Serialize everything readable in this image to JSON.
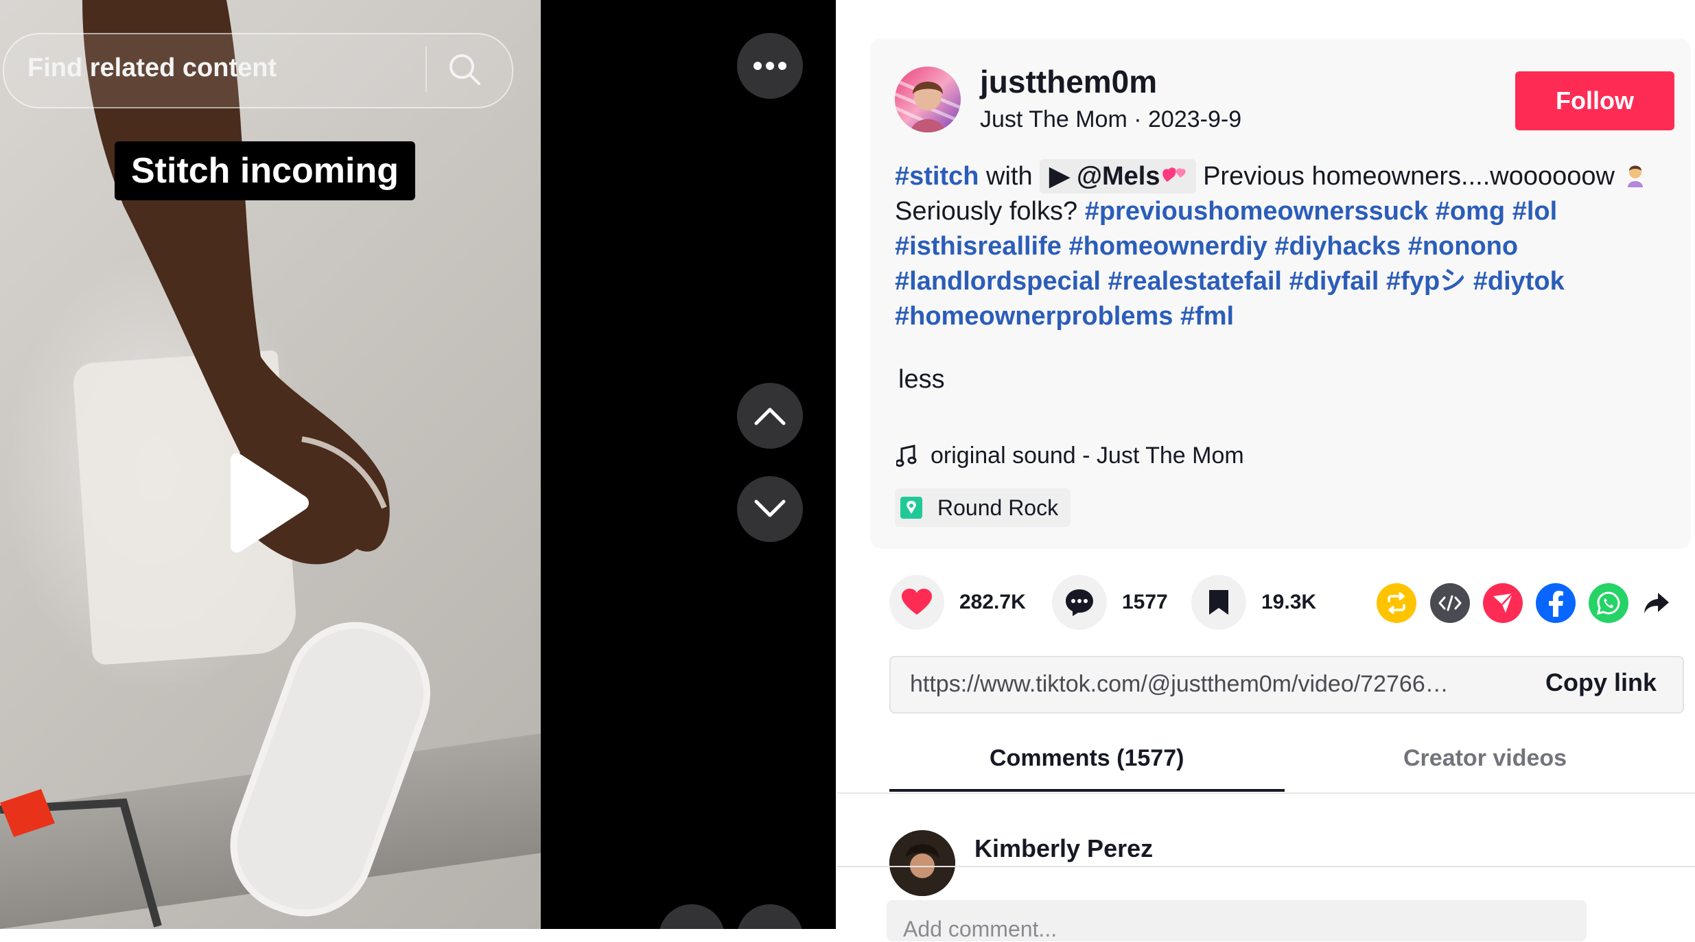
{
  "search": {
    "placeholder": "Find related content"
  },
  "video": {
    "caption": "Stitch incoming"
  },
  "author": {
    "username": "justthem0m",
    "nickname": "Just The Mom",
    "date": "2023-9-9",
    "follow_label": "Follow"
  },
  "description": {
    "stitch_tag": "#stitch",
    "with_text": "with",
    "stitch_mention": "@Mels",
    "text_1": "Previous homeowners....woooooow",
    "text_2": "Seriously folks?",
    "hashtags": [
      "#previoushomeownerssuck",
      "#omg",
      "#lol",
      "#isthisreallife",
      "#homeownerdiy",
      "#diyhacks",
      "#nonono",
      "#landlordspecial",
      "#realestatefail",
      "#diyfail",
      "#fypシ",
      "#diytok",
      "#homeownerproblems",
      "#fml"
    ],
    "less_label": "less"
  },
  "sound": {
    "label": "original sound - Just The Mom"
  },
  "location": {
    "label": "Round Rock"
  },
  "stats": {
    "likes": "282.7K",
    "comments": "1577",
    "saves": "19.3K"
  },
  "share": {
    "icons": [
      "repost-icon",
      "embed-icon",
      "send-icon",
      "facebook-icon",
      "whatsapp-icon",
      "share-arrow-icon"
    ],
    "colors": {
      "repost": "#ffc300",
      "embed": "#4a4a52",
      "send": "#fe2c55",
      "facebook": "#0866ff",
      "whatsapp": "#25d366"
    }
  },
  "link": {
    "url": "https://www.tiktok.com/@justthem0m/video/72766370...",
    "copy_label": "Copy link"
  },
  "tabs": {
    "comments": "Comments (1577)",
    "creator_videos": "Creator videos"
  },
  "comments": [
    {
      "name": "Kimberly Perez"
    }
  ],
  "comment_input": {
    "placeholder": "Add comment..."
  },
  "colors": {
    "accent": "#fe2c55",
    "hashtag": "#2b5db9",
    "text": "#161823"
  }
}
